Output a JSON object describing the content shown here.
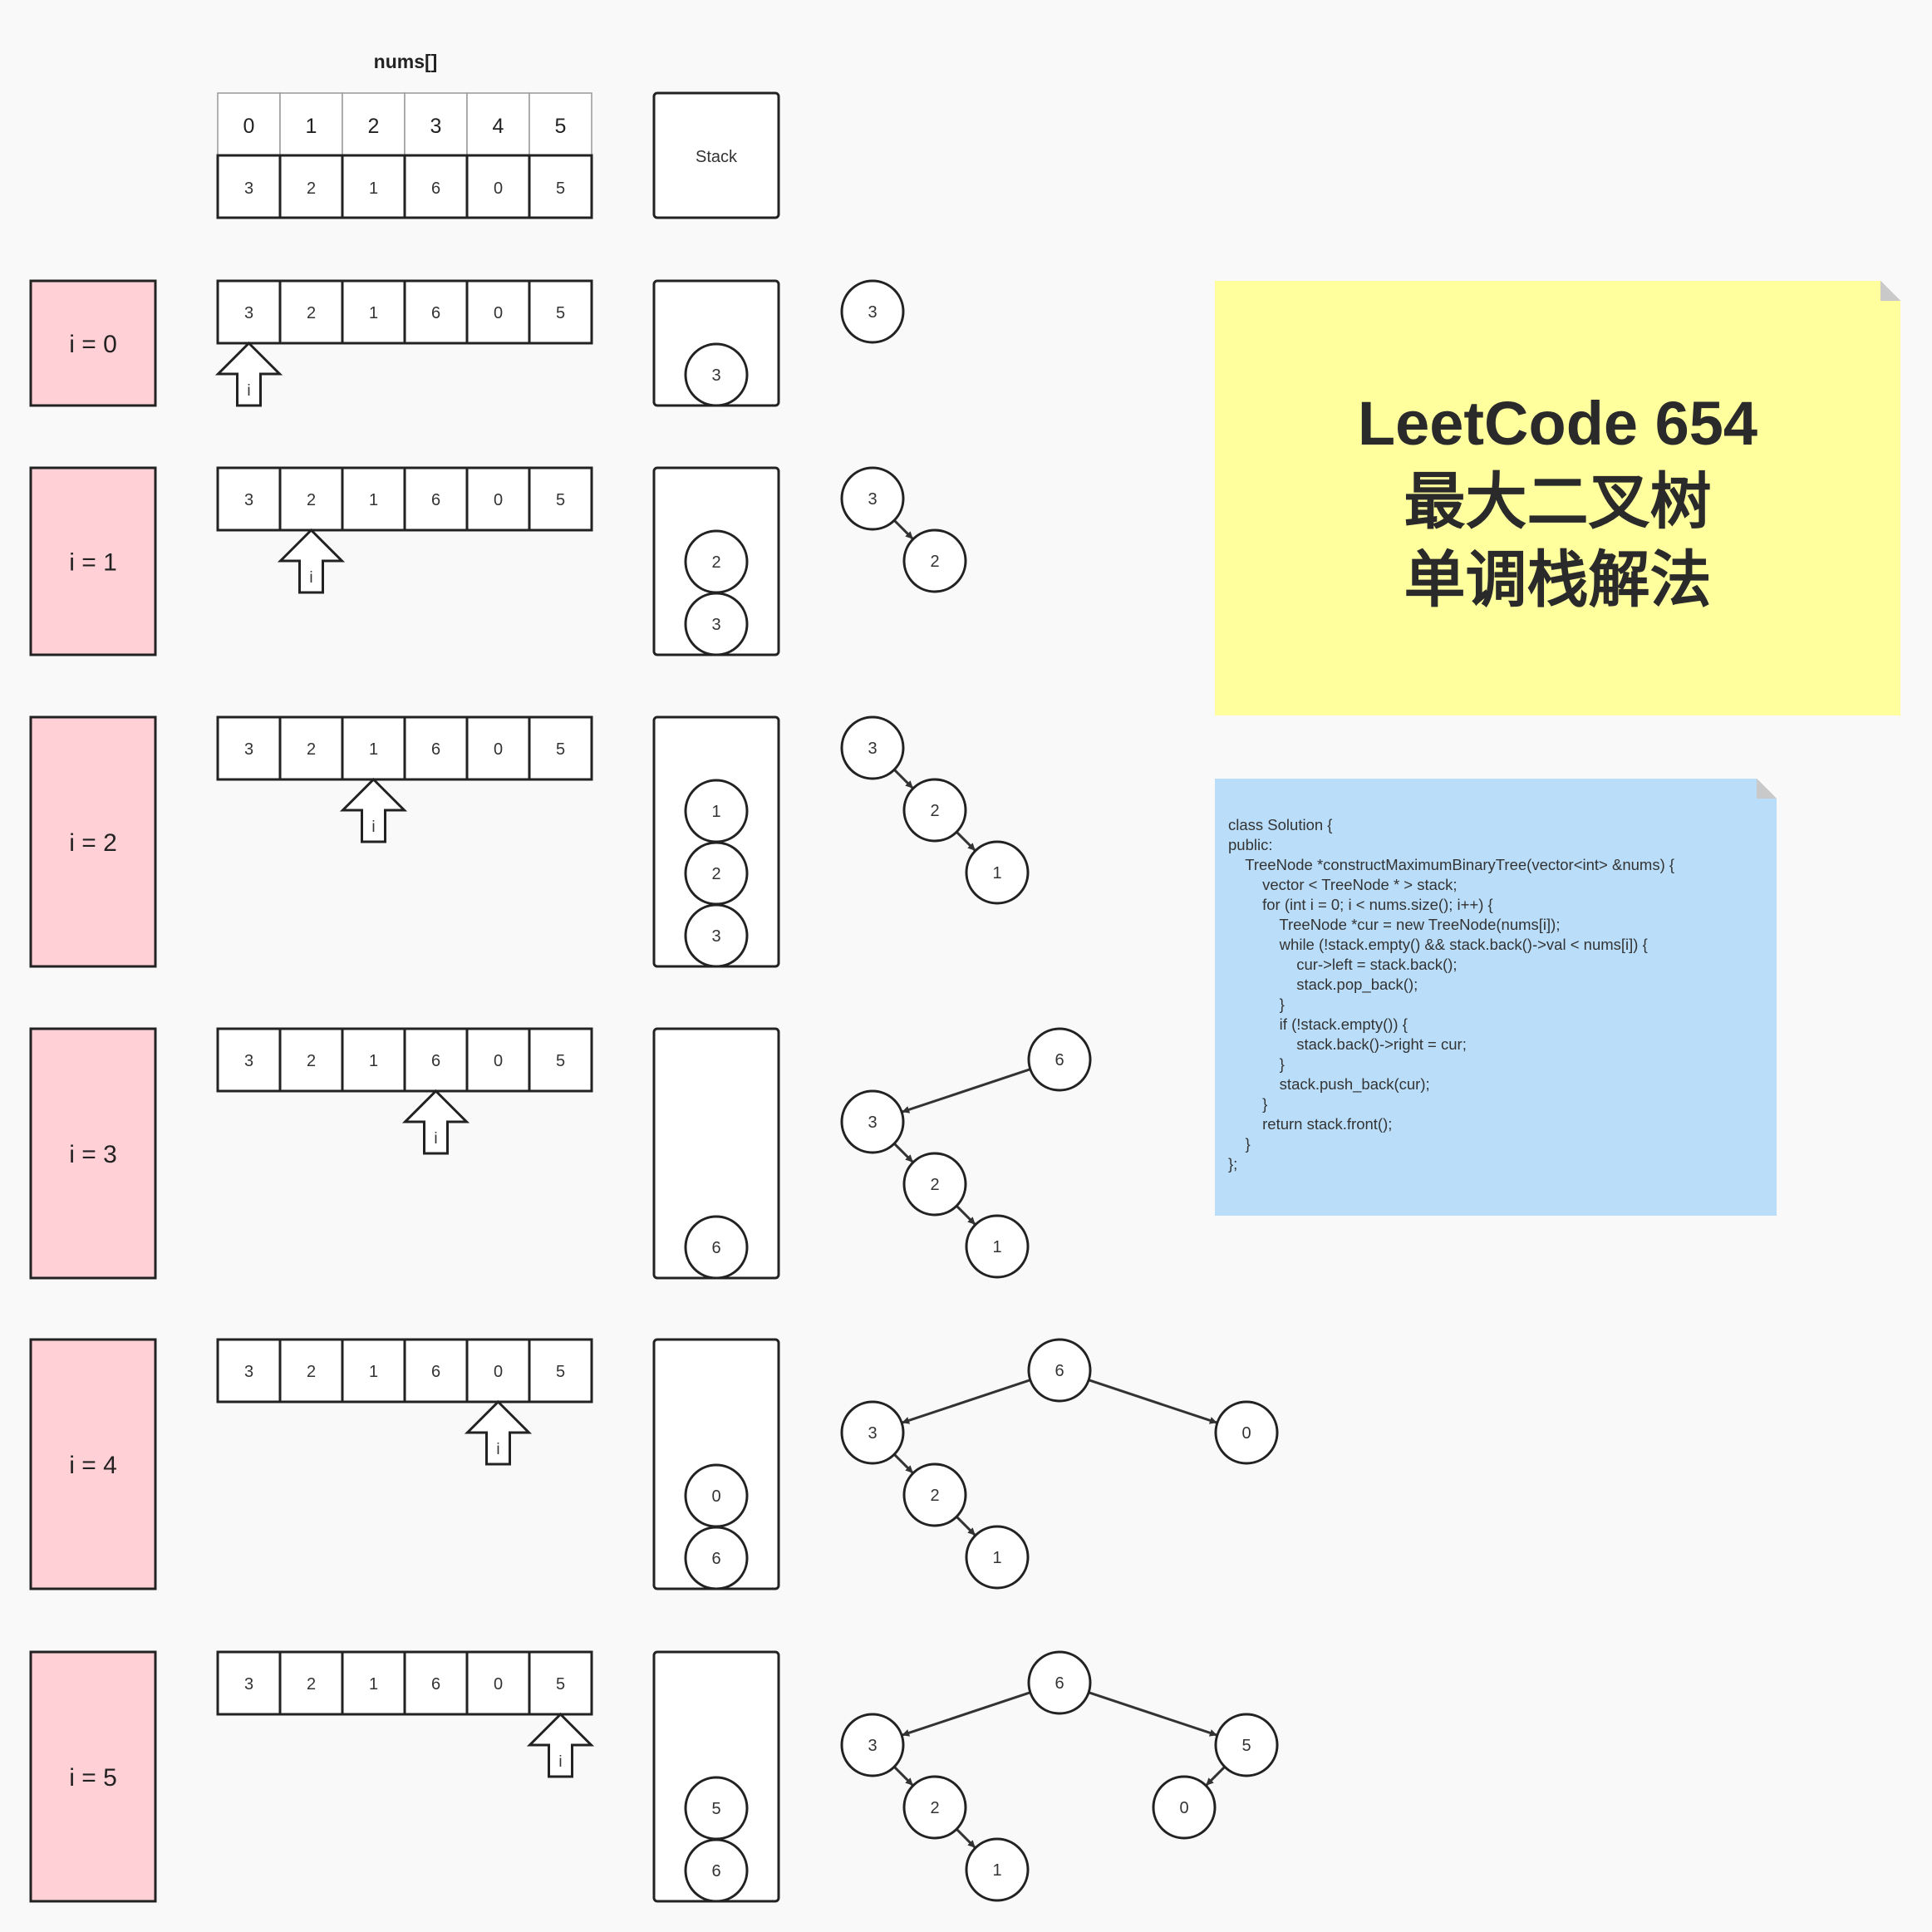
{
  "array_label": "nums[]",
  "indices": [
    "0",
    "1",
    "2",
    "3",
    "4",
    "5"
  ],
  "nums": [
    "3",
    "2",
    "1",
    "6",
    "0",
    "5"
  ],
  "stack_label": "Stack",
  "pointer_label": "i",
  "steps": [
    {
      "label": "i = 0",
      "pointer": 0,
      "stack": [
        "3"
      ],
      "tree": {
        "nodes": [
          {
            "id": "n3",
            "v": "3",
            "c": 0,
            "r": 0
          }
        ],
        "edges": []
      }
    },
    {
      "label": "i = 1",
      "pointer": 1,
      "stack": [
        "3",
        "2"
      ],
      "tree": {
        "nodes": [
          {
            "id": "n3",
            "v": "3",
            "c": 0,
            "r": 0
          },
          {
            "id": "n2",
            "v": "2",
            "c": 1,
            "r": 1
          }
        ],
        "edges": [
          [
            "n3",
            "n2"
          ]
        ]
      }
    },
    {
      "label": "i = 2",
      "pointer": 2,
      "stack": [
        "3",
        "2",
        "1"
      ],
      "tree": {
        "nodes": [
          {
            "id": "n3",
            "v": "3",
            "c": 0,
            "r": 0
          },
          {
            "id": "n2",
            "v": "2",
            "c": 1,
            "r": 1
          },
          {
            "id": "n1",
            "v": "1",
            "c": 2,
            "r": 2
          }
        ],
        "edges": [
          [
            "n3",
            "n2"
          ],
          [
            "n2",
            "n1"
          ]
        ]
      }
    },
    {
      "label": "i = 3",
      "pointer": 3,
      "stack": [
        "6"
      ],
      "tree": {
        "nodes": [
          {
            "id": "n6",
            "v": "6",
            "c": 3,
            "r": 0
          },
          {
            "id": "n3",
            "v": "3",
            "c": 0,
            "r": 1
          },
          {
            "id": "n2",
            "v": "2",
            "c": 1,
            "r": 2
          },
          {
            "id": "n1",
            "v": "1",
            "c": 2,
            "r": 3
          }
        ],
        "edges": [
          [
            "n6",
            "n3"
          ],
          [
            "n3",
            "n2"
          ],
          [
            "n2",
            "n1"
          ]
        ]
      }
    },
    {
      "label": "i = 4",
      "pointer": 4,
      "stack": [
        "6",
        "0"
      ],
      "tree": {
        "nodes": [
          {
            "id": "n6",
            "v": "6",
            "c": 3,
            "r": 0
          },
          {
            "id": "n3",
            "v": "3",
            "c": 0,
            "r": 1
          },
          {
            "id": "n2",
            "v": "2",
            "c": 1,
            "r": 2
          },
          {
            "id": "n1",
            "v": "1",
            "c": 2,
            "r": 3
          },
          {
            "id": "n0",
            "v": "0",
            "c": 6,
            "r": 1
          }
        ],
        "edges": [
          [
            "n6",
            "n3"
          ],
          [
            "n3",
            "n2"
          ],
          [
            "n2",
            "n1"
          ],
          [
            "n6",
            "n0"
          ]
        ]
      }
    },
    {
      "label": "i = 5",
      "pointer": 5,
      "stack": [
        "6",
        "5"
      ],
      "tree": {
        "nodes": [
          {
            "id": "n6",
            "v": "6",
            "c": 3,
            "r": 0
          },
          {
            "id": "n3",
            "v": "3",
            "c": 0,
            "r": 1
          },
          {
            "id": "n2",
            "v": "2",
            "c": 1,
            "r": 2
          },
          {
            "id": "n1",
            "v": "1",
            "c": 2,
            "r": 3
          },
          {
            "id": "n5",
            "v": "5",
            "c": 6,
            "r": 1
          },
          {
            "id": "n0",
            "v": "0",
            "c": 5,
            "r": 2
          }
        ],
        "edges": [
          [
            "n6",
            "n3"
          ],
          [
            "n3",
            "n2"
          ],
          [
            "n2",
            "n1"
          ],
          [
            "n6",
            "n5"
          ],
          [
            "n5",
            "n0"
          ]
        ]
      }
    }
  ],
  "title_lines": [
    "LeetCode 654",
    "最大二叉树",
    "单调栈解法"
  ],
  "code_lines": [
    "class Solution {",
    "public:",
    "    TreeNode *constructMaximumBinaryTree(vector<int> &nums) {",
    "        vector < TreeNode * > stack;",
    "        for (int i = 0; i < nums.size(); i++) {",
    "            TreeNode *cur = new TreeNode(nums[i]);",
    "            while (!stack.empty() && stack.back()->val < nums[i]) {",
    "                cur->left = stack.back();",
    "                stack.pop_back();",
    "            }",
    "            if (!stack.empty()) {",
    "                stack.back()->right = cur;",
    "            }",
    "            stack.push_back(cur);",
    "        }",
    "        return stack.front();",
    "    }",
    "};"
  ],
  "colors": {
    "step_label_bg": "#ffd0d6",
    "title_note_bg": "#ffff9e",
    "code_note_bg": "#badefa",
    "stroke": "#222222"
  }
}
